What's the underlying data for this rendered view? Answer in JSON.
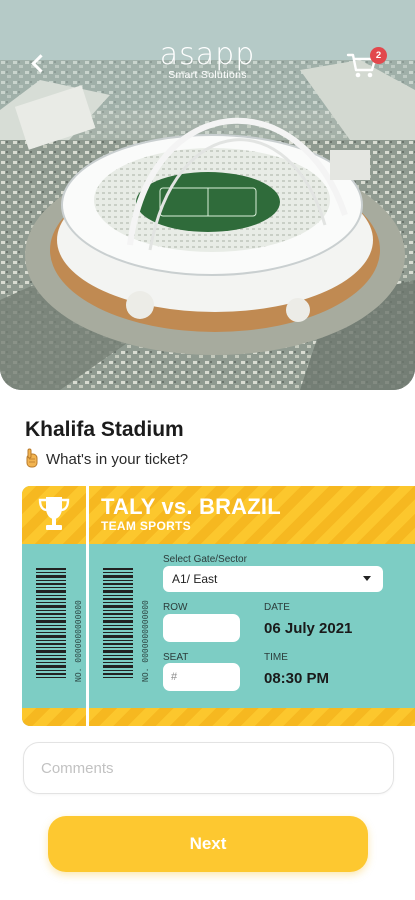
{
  "header": {
    "logo_word": "asapp",
    "logo_tagline": "Smart Solutions",
    "cart_count": "2"
  },
  "venue": {
    "name": "Khalifa Stadium",
    "ticket_prompt": "What's in your ticket?"
  },
  "ticket": {
    "match_title": "TALY vs. BRAZIL",
    "category": "TEAM SPORTS",
    "barcode_number": "NO. 0000000000000",
    "gate_label": "Select Gate/Sector",
    "gate_value": "A1/ East",
    "row_label": "ROW",
    "row_value": "",
    "seat_label": "SEAT",
    "seat_placeholder": "#",
    "date_label": "DATE",
    "date_value": "06 July 2021",
    "time_label": "TIME",
    "time_value": "08:30 PM"
  },
  "form": {
    "comments_placeholder": "Comments",
    "next_label": "Next"
  },
  "colors": {
    "accent_yellow": "#fdc830",
    "ticket_teal": "#7dcdc4",
    "badge_red": "#e2484d"
  },
  "icons": {
    "back": "chevron-left-icon",
    "cart": "shopping-cart-icon",
    "hint": "hand-icon",
    "trophy": "trophy-icon"
  }
}
